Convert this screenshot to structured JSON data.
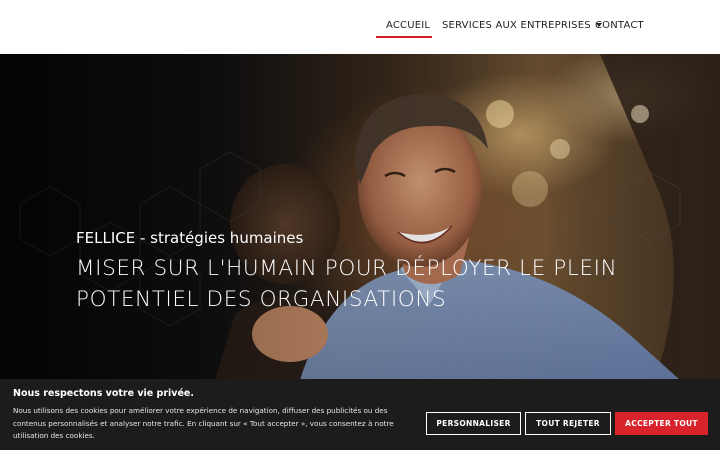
{
  "nav": {
    "items": [
      {
        "label": "ACCUEIL",
        "active": true
      },
      {
        "label": "SERVICES AUX ENTREPRISES",
        "has_dropdown": true
      },
      {
        "label": "CONTACT"
      }
    ]
  },
  "hero": {
    "subtitle": "FELLICE - stratégies humaines",
    "title_line1": "MISER SUR L'HUMAIN POUR DÉPLOYER LE PLEIN",
    "title_line2": "POTENTIEL DES ORGANISATIONS"
  },
  "cookie_banner": {
    "title": "Nous respectons votre vie privée.",
    "text": "Nous utilisons des cookies pour améliorer votre expérience de navigation, diffuser des publicités ou des contenus personnalisés et analyser notre trafic. En cliquant sur « Tout accepter », vous consentez à notre utilisation des cookies.",
    "customize_label": "PERSONNALISER",
    "reject_label": "TOUT REJETER",
    "accept_label": "ACCEPTER TOUT"
  },
  "colors": {
    "accent": "#d8232a",
    "banner_bg": "#1c1c1c"
  },
  "icons": {
    "dropdown": "chevron-down-icon"
  }
}
